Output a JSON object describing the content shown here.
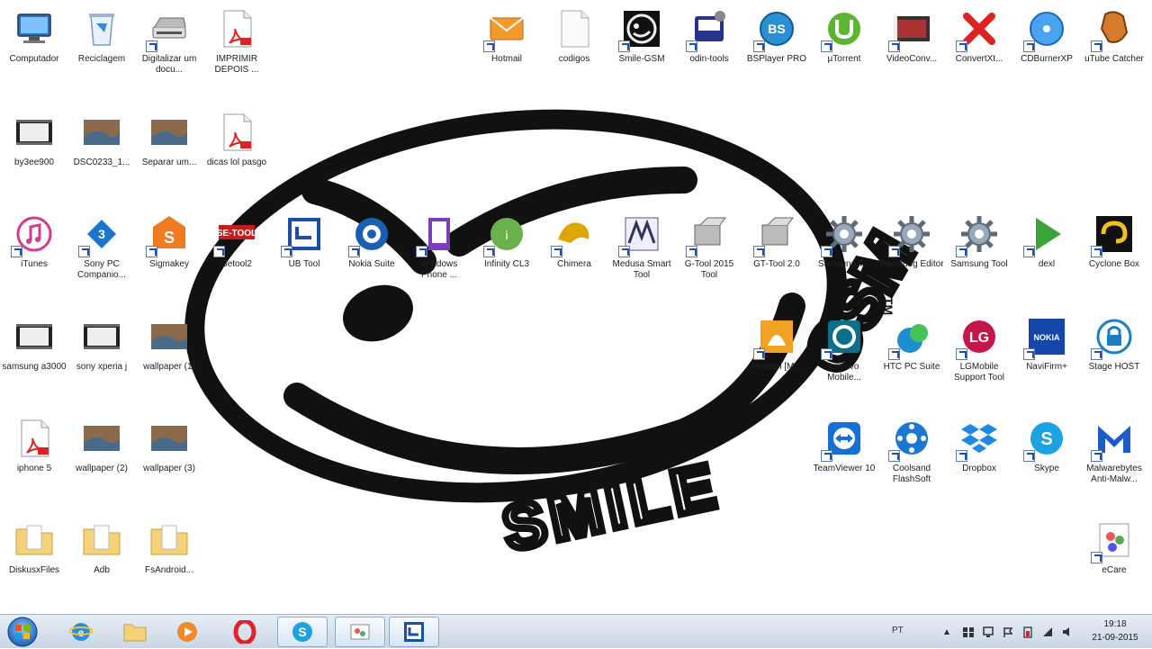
{
  "desktop": {
    "icons": [
      {
        "label": "Computador",
        "glyph": "computer-icon"
      },
      {
        "label": "Reciclagem",
        "glyph": "recycle-bin-icon"
      },
      {
        "label": "Digitalizar um docu...",
        "glyph": "scanner-icon"
      },
      {
        "label": "IMPRIMIR DEPOIS ...",
        "glyph": "pdf-icon"
      },
      {
        "label": "Hotmail",
        "glyph": "mail-icon"
      },
      {
        "label": "codigos",
        "glyph": "document-icon"
      },
      {
        "label": "Smile-GSM",
        "glyph": "smile-icon"
      },
      {
        "label": "odin-tools",
        "glyph": "odin-icon"
      },
      {
        "label": "BSPlayer PRO",
        "glyph": "bsplayer-icon"
      },
      {
        "label": "µTorrent",
        "glyph": "utorrent-icon"
      },
      {
        "label": "VideoConv...",
        "glyph": "video-icon"
      },
      {
        "label": "ConvertXt...",
        "glyph": "convertx-icon"
      },
      {
        "label": "CDBurnerXP",
        "glyph": "disc-icon"
      },
      {
        "label": "uTube Catcher",
        "glyph": "catcher-icon"
      },
      {
        "label": "by3ee900",
        "glyph": "video-file-icon"
      },
      {
        "label": "DSC0233_1...",
        "glyph": "photo-icon"
      },
      {
        "label": "Separar um...",
        "glyph": "photo-icon"
      },
      {
        "label": "dicas lol pasgo",
        "glyph": "pdf-icon"
      },
      {
        "label": "iTunes",
        "glyph": "itunes-icon"
      },
      {
        "label": "Sony PC Companio...",
        "glyph": "sony-icon"
      },
      {
        "label": "Sigmakey",
        "glyph": "sigmakey-icon"
      },
      {
        "label": "Setool2",
        "glyph": "setool-icon"
      },
      {
        "label": "UB Tool",
        "glyph": "ub-icon"
      },
      {
        "label": "Nokia Suite",
        "glyph": "nokia-suite-icon"
      },
      {
        "label": "Windows Phone ...",
        "glyph": "winphone-icon"
      },
      {
        "label": "Infinity CL3",
        "glyph": "infinity-icon"
      },
      {
        "label": "Chimera",
        "glyph": "chimera-icon"
      },
      {
        "label": "Medusa Smart Tool",
        "glyph": "medusa-icon"
      },
      {
        "label": "G-Tool 2015 Tool",
        "glyph": "tool-icon"
      },
      {
        "label": "GT-Tool 2.0",
        "glyph": "tool-icon"
      },
      {
        "label": "Samsung T...",
        "glyph": "gear-icon"
      },
      {
        "label": "Samsung Editor",
        "glyph": "gear-icon"
      },
      {
        "label": "Samsung Tool",
        "glyph": "gear-icon"
      },
      {
        "label": "dexl",
        "glyph": "play-icon"
      },
      {
        "label": "Cyclone Box",
        "glyph": "cyclone-icon"
      },
      {
        "label": "samsung a3000",
        "glyph": "video-file-icon"
      },
      {
        "label": "sony xperia j",
        "glyph": "video-file-icon"
      },
      {
        "label": "wallpaper (1)",
        "glyph": "photo-icon"
      },
      {
        "label": "Huawei [M...",
        "glyph": "huawei-icon"
      },
      {
        "label": "Lenovo Mobile...",
        "glyph": "lenovo-icon"
      },
      {
        "label": "HTC PC Suite",
        "glyph": "htc-icon"
      },
      {
        "label": "LGMobile Support Tool",
        "glyph": "lg-icon"
      },
      {
        "label": "NaviFirm+",
        "glyph": "nokia-icon"
      },
      {
        "label": "Stage HOST",
        "glyph": "lock-icon"
      },
      {
        "label": "iphone 5",
        "glyph": "pdf-icon"
      },
      {
        "label": "wallpaper (2)",
        "glyph": "photo-icon"
      },
      {
        "label": "wallpaper (3)",
        "glyph": "photo-icon"
      },
      {
        "label": "TeamViewer 10",
        "glyph": "teamviewer-icon"
      },
      {
        "label": "Coolsand FlashSoft",
        "glyph": "coolsand-icon"
      },
      {
        "label": "Dropbox",
        "glyph": "dropbox-icon"
      },
      {
        "label": "Skype",
        "glyph": "skype-icon"
      },
      {
        "label": "Malwarebytes Anti-Malw...",
        "glyph": "malwarebytes-icon"
      },
      {
        "label": "DiskusxFiles",
        "glyph": "folder-icon"
      },
      {
        "label": "Adb",
        "glyph": "folder-icon"
      },
      {
        "label": "FsAndroid...",
        "glyph": "folder-icon"
      },
      {
        "label": "eCare",
        "glyph": "ecare-icon"
      }
    ]
  },
  "wallpaper": {
    "brand": "SMILE GSM",
    "tm": "TM"
  },
  "taskbar": {
    "items": [
      "start-orb-icon",
      "ie-icon",
      "explorer-icon",
      "media-player-icon",
      "opera-icon",
      "skype-icon",
      "paint-icon",
      "ub-icon"
    ],
    "tray": {
      "language": "PT",
      "time": "19:18",
      "date": "21-09-2015"
    }
  },
  "colors": {
    "taskbar": "#c9d6e6",
    "accent": "#1f4fb0",
    "background": "#ffffff"
  }
}
